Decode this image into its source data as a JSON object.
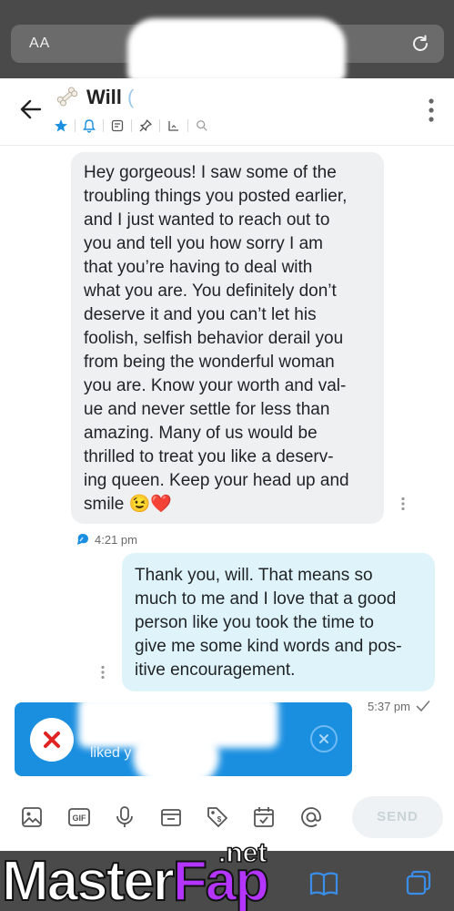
{
  "browser": {
    "text_size_label": "AA"
  },
  "header": {
    "contact_name": "Will",
    "contact_name_extra": "("
  },
  "messages": {
    "incoming": {
      "text": "Hey gorgeous! I saw some of the\ntroubling things you posted earlier,\nand I just wanted to reach out to\nyou and tell you how sorry I am\nthat you’re having to deal with\nwhat you are. You definitely don’t\ndeserve it and you can’t let his\nfoolish, selfish behavior derail you\nfrom being the wonderful woman\nyou are. Know your worth and val-\nue and never settle for less than\namazing. Many of us would be\nthrilled to treat you like a deserv-\ning queen. Keep your head up and\nsmile 😉❤️",
      "time": "4:21 pm"
    },
    "outgoing": {
      "text": "Thank you, will. That means so\nmuch to me and I love that a good\nperson like you took the time to\ngive me some kind words and pos-\nitive encouragement.",
      "time": "5:37 pm"
    }
  },
  "toast": {
    "text": "liked y"
  },
  "composer": {
    "send_label": "SEND"
  },
  "watermark": {
    "brand_part1": "Master",
    "brand_part2": "Fap",
    "domain": ".net"
  },
  "colors": {
    "accent": "#1a8fe0",
    "incoming_bubble": "#eef0f1",
    "outgoing_bubble": "#dff3fb",
    "browser_chrome": "#4a4a4a"
  }
}
